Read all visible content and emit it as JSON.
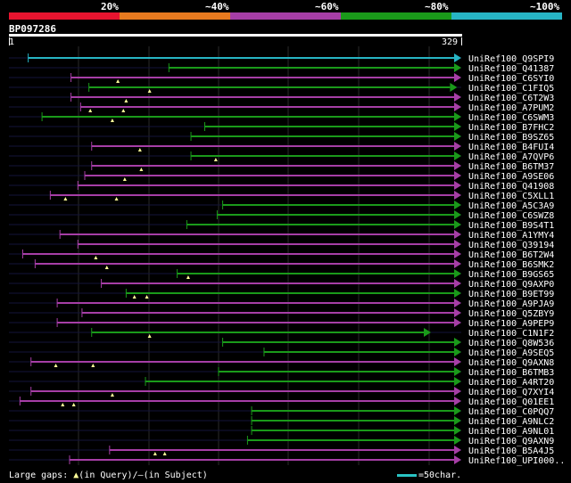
{
  "identity_legend": {
    "segments": [
      {
        "color": "#e8142f"
      },
      {
        "color": "#e87a1f"
      },
      {
        "color": "#a63ea6"
      },
      {
        "color": "#1a9a1a"
      },
      {
        "color": "#27b4c4"
      }
    ],
    "labels": [
      "20%",
      "~40%",
      "~60%",
      "~80%",
      "~100%"
    ]
  },
  "query": {
    "name": "BP097286",
    "start": "1",
    "end": "329"
  },
  "hits": [
    {
      "name": "UniRef100_Q9SPI9",
      "start": 15,
      "end": 329,
      "color": "#27b4c4",
      "gaps": []
    },
    {
      "name": "UniRef100_Q41387",
      "start": 117,
      "end": 329,
      "color": "#1a9a1a",
      "gaps": []
    },
    {
      "name": "UniRef100_C6SYI0",
      "start": 46,
      "end": 329,
      "color": "#a63ea6",
      "gaps": [
        80
      ]
    },
    {
      "name": "UniRef100_C1FIQ5",
      "start": 59,
      "end": 326,
      "color": "#1a9a1a",
      "gaps": [
        103
      ]
    },
    {
      "name": "UniRef100_C6T2W3",
      "start": 46,
      "end": 329,
      "color": "#a63ea6",
      "gaps": [
        86
      ]
    },
    {
      "name": "UniRef100_A7PUM2",
      "start": 53,
      "end": 329,
      "color": "#a63ea6",
      "gaps": [
        60,
        84
      ]
    },
    {
      "name": "UniRef100_C6SWM3",
      "start": 25,
      "end": 329,
      "color": "#1a9a1a",
      "gaps": [
        76
      ]
    },
    {
      "name": "UniRef100_B7FHC2",
      "start": 143,
      "end": 329,
      "color": "#1a9a1a",
      "gaps": []
    },
    {
      "name": "UniRef100_B9SZ65",
      "start": 133,
      "end": 329,
      "color": "#1a9a1a",
      "gaps": []
    },
    {
      "name": "UniRef100_B4FUI4",
      "start": 61,
      "end": 329,
      "color": "#a63ea6",
      "gaps": [
        96
      ]
    },
    {
      "name": "UniRef100_A7QVP6",
      "start": 133,
      "end": 329,
      "color": "#1a9a1a",
      "gaps": [
        151
      ]
    },
    {
      "name": "UniRef100_B6TM37",
      "start": 61,
      "end": 329,
      "color": "#a63ea6",
      "gaps": [
        97
      ]
    },
    {
      "name": "UniRef100_A9SE06",
      "start": 56,
      "end": 329,
      "color": "#a63ea6",
      "gaps": [
        85
      ]
    },
    {
      "name": "UniRef100_Q41908",
      "start": 51,
      "end": 329,
      "color": "#a63ea6",
      "gaps": []
    },
    {
      "name": "UniRef100_C5XLL1",
      "start": 31,
      "end": 329,
      "color": "#a63ea6",
      "gaps": [
        42,
        79
      ]
    },
    {
      "name": "UniRef100_A5C3A9",
      "start": 156,
      "end": 329,
      "color": "#1a9a1a",
      "gaps": []
    },
    {
      "name": "UniRef100_C6SWZ8",
      "start": 152,
      "end": 329,
      "color": "#1a9a1a",
      "gaps": []
    },
    {
      "name": "UniRef100_B9S4T1",
      "start": 130,
      "end": 329,
      "color": "#1a9a1a",
      "gaps": []
    },
    {
      "name": "UniRef100_A1YMY4",
      "start": 38,
      "end": 329,
      "color": "#a63ea6",
      "gaps": []
    },
    {
      "name": "UniRef100_Q39194",
      "start": 51,
      "end": 329,
      "color": "#a63ea6",
      "gaps": []
    },
    {
      "name": "UniRef100_B6T2W4",
      "start": 11,
      "end": 329,
      "color": "#a63ea6",
      "gaps": [
        64
      ]
    },
    {
      "name": "UniRef100_B6SMK2",
      "start": 20,
      "end": 329,
      "color": "#a63ea6",
      "gaps": [
        72
      ]
    },
    {
      "name": "UniRef100_B9GS65",
      "start": 123,
      "end": 329,
      "color": "#1a9a1a",
      "gaps": [
        131
      ]
    },
    {
      "name": "UniRef100_Q9AXP0",
      "start": 68,
      "end": 329,
      "color": "#a63ea6",
      "gaps": []
    },
    {
      "name": "UniRef100_B9ET99",
      "start": 86,
      "end": 329,
      "color": "#1a9a1a",
      "gaps": [
        92,
        101
      ]
    },
    {
      "name": "UniRef100_A9PJA9",
      "start": 36,
      "end": 329,
      "color": "#a63ea6",
      "gaps": []
    },
    {
      "name": "UniRef100_Q5ZBY9",
      "start": 54,
      "end": 329,
      "color": "#a63ea6",
      "gaps": []
    },
    {
      "name": "UniRef100_A9PEP9",
      "start": 36,
      "end": 329,
      "color": "#a63ea6",
      "gaps": []
    },
    {
      "name": "UniRef100_C1N1F2",
      "start": 61,
      "end": 307,
      "color": "#1a9a1a",
      "gaps": [
        103
      ]
    },
    {
      "name": "UniRef100_Q8W536",
      "start": 156,
      "end": 329,
      "color": "#1a9a1a",
      "gaps": []
    },
    {
      "name": "UniRef100_A9SEQ5",
      "start": 186,
      "end": 329,
      "color": "#1a9a1a",
      "gaps": []
    },
    {
      "name": "UniRef100_Q9AXN8",
      "start": 17,
      "end": 329,
      "color": "#a63ea6",
      "gaps": [
        35,
        62
      ]
    },
    {
      "name": "UniRef100_B6TMB3",
      "start": 153,
      "end": 329,
      "color": "#1a9a1a",
      "gaps": []
    },
    {
      "name": "UniRef100_A4RT20",
      "start": 100,
      "end": 329,
      "color": "#1a9a1a",
      "gaps": []
    },
    {
      "name": "UniRef100_Q7XYI4",
      "start": 17,
      "end": 329,
      "color": "#a63ea6",
      "gaps": [
        76
      ]
    },
    {
      "name": "UniRef100_Q01EE1",
      "start": 9,
      "end": 329,
      "color": "#a63ea6",
      "gaps": [
        40,
        48
      ]
    },
    {
      "name": "UniRef100_C0PQQ7",
      "start": 177,
      "end": 329,
      "color": "#1a9a1a",
      "gaps": []
    },
    {
      "name": "UniRef100_A9NLC2",
      "start": 177,
      "end": 329,
      "color": "#1a9a1a",
      "gaps": []
    },
    {
      "name": "UniRef100_A9NL01",
      "start": 177,
      "end": 329,
      "color": "#1a9a1a",
      "gaps": []
    },
    {
      "name": "UniRef100_Q9AXN9",
      "start": 174,
      "end": 329,
      "color": "#1a9a1a",
      "gaps": []
    },
    {
      "name": "UniRef100_B5A4J5",
      "start": 74,
      "end": 329,
      "color": "#a63ea6",
      "gaps": [
        107,
        114
      ]
    },
    {
      "name": "UniRef100_UPI000..",
      "start": 45,
      "end": 329,
      "color": "#a63ea6",
      "gaps": []
    }
  ],
  "footer": {
    "prefix": "Large gaps:",
    "query_mark": "▲",
    "query_text": "(in Query)/",
    "subject_mark": "–",
    "subject_text": "(in Subject)",
    "scale_text": "=50char."
  }
}
